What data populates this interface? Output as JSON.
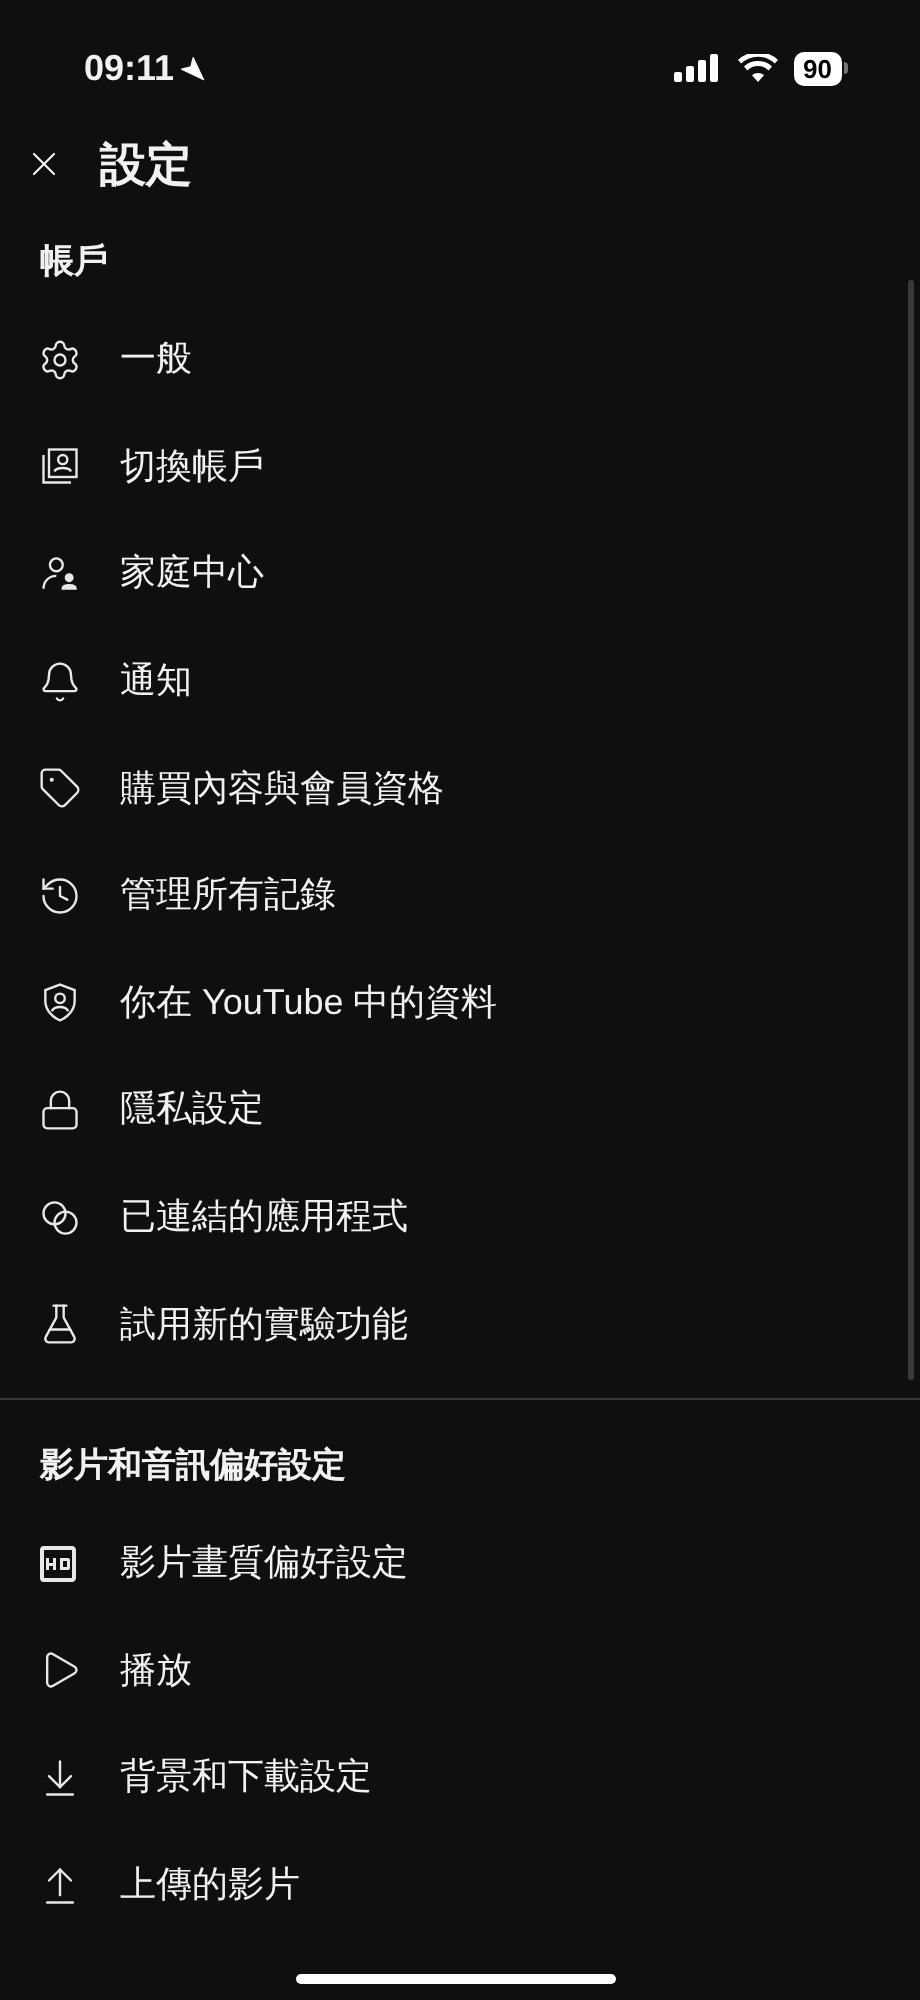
{
  "status_bar": {
    "time": "09:11",
    "battery": "90"
  },
  "header": {
    "title": "設定"
  },
  "sections": [
    {
      "title": "帳戶",
      "items": [
        {
          "label": "一般"
        },
        {
          "label": "切換帳戶"
        },
        {
          "label": "家庭中心"
        },
        {
          "label": "通知"
        },
        {
          "label": "購買內容與會員資格"
        },
        {
          "label": "管理所有記錄"
        },
        {
          "label": "你在 YouTube 中的資料"
        },
        {
          "label": "隱私設定"
        },
        {
          "label": "已連結的應用程式"
        },
        {
          "label": "試用新的實驗功能"
        }
      ]
    },
    {
      "title": "影片和音訊偏好設定",
      "items": [
        {
          "label": "影片畫質偏好設定"
        },
        {
          "label": "播放"
        },
        {
          "label": "背景和下載設定"
        },
        {
          "label": "上傳的影片"
        }
      ]
    }
  ]
}
